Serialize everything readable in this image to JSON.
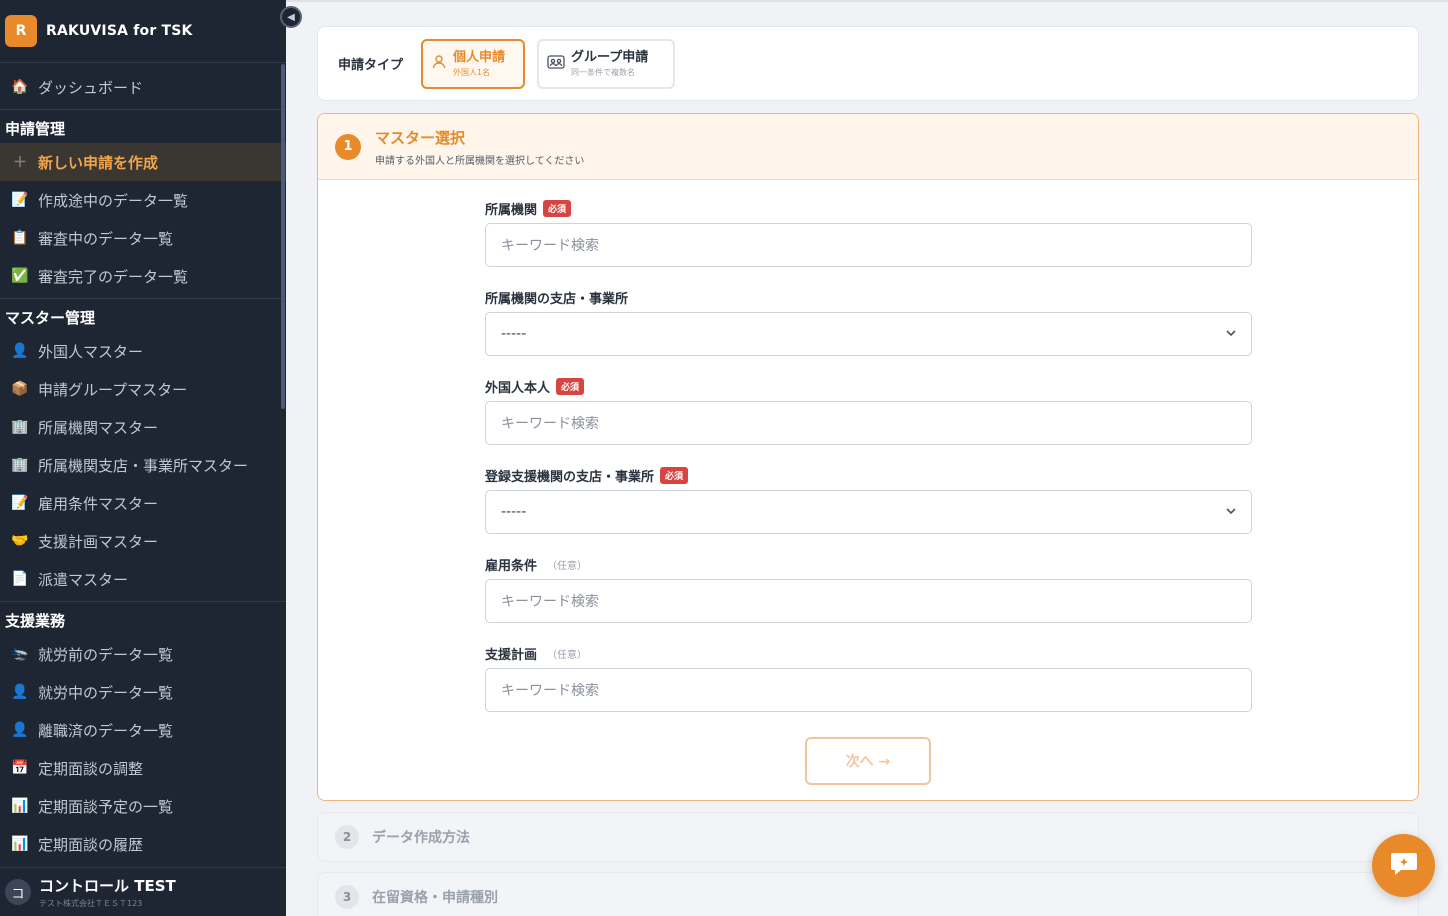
{
  "brand": {
    "logo_letter": "R",
    "title": "RAKUVISA for TSK"
  },
  "sidebar": {
    "dashboard": {
      "icon": "home-icon",
      "label": "ダッシュボード"
    },
    "sections": [
      {
        "title": "申請管理",
        "items": [
          {
            "icon": "plus-icon",
            "label": "新しい申請を作成",
            "active": true
          },
          {
            "icon": "memo-icon",
            "label": "作成途中のデータ一覧"
          },
          {
            "icon": "clipboard-icon",
            "label": "審査中のデータ一覧"
          },
          {
            "icon": "check-icon",
            "label": "審査完了のデータ一覧"
          }
        ]
      },
      {
        "title": "マスター管理",
        "items": [
          {
            "icon": "person-icon",
            "label": "外国人マスター"
          },
          {
            "icon": "package-icon",
            "label": "申請グループマスター"
          },
          {
            "icon": "building-icon",
            "label": "所属機関マスター"
          },
          {
            "icon": "building-icon",
            "label": "所属機関支店・事業所マスター"
          },
          {
            "icon": "memo-icon",
            "label": "雇用条件マスター"
          },
          {
            "icon": "handshake-icon",
            "label": "支援計画マスター"
          },
          {
            "icon": "document-icon",
            "label": "派遣マスター"
          }
        ]
      },
      {
        "title": "支援業務",
        "items": [
          {
            "icon": "airplane-icon",
            "label": "就労前のデータ一覧"
          },
          {
            "icon": "person-icon",
            "label": "就労中のデータ一覧"
          },
          {
            "icon": "person-icon",
            "label": "離職済のデータ一覧"
          },
          {
            "icon": "calendar-icon",
            "label": "定期面談の調整"
          },
          {
            "icon": "chart-icon",
            "label": "定期面談予定の一覧"
          },
          {
            "icon": "chart-icon",
            "label": "定期面談の履歴"
          }
        ]
      }
    ]
  },
  "user": {
    "avatar_letter": "コ",
    "name": "コントロール TEST",
    "org": "テスト株式会社ＴＥＳＴ123"
  },
  "application_type": {
    "label": "申請タイプ",
    "individual": {
      "title": "個人申請",
      "sub": "外国人1名"
    },
    "group": {
      "title": "グループ申請",
      "sub": "同一条件で複数名"
    }
  },
  "step1": {
    "number": "1",
    "title": "マスター選択",
    "description": "申請する外国人と所属機関を選択してください",
    "fields": [
      {
        "label": "所属機関",
        "badge": "必須",
        "type": "search",
        "placeholder": "キーワード検索"
      },
      {
        "label": "所属機関の支店・事業所",
        "badge": "",
        "type": "select",
        "value": "-----"
      },
      {
        "label": "外国人本人",
        "badge": "必須",
        "type": "search",
        "placeholder": "キーワード検索"
      },
      {
        "label": "登録支援機関の支店・事業所",
        "badge": "必須",
        "type": "select",
        "value": "-----"
      },
      {
        "label": "雇用条件",
        "optional": "（任意）",
        "type": "search",
        "placeholder": "キーワード検索"
      },
      {
        "label": "支援計画",
        "optional": "（任意）",
        "type": "search",
        "placeholder": "キーワード検索"
      }
    ],
    "next_label": "次へ →"
  },
  "step2": {
    "number": "2",
    "title": "データ作成方法"
  },
  "step3": {
    "number": "3",
    "title": "在留資格・申請種別"
  },
  "colors": {
    "accent": "#e8892a",
    "sidebar_bg": "#1e2533",
    "required": "#d64541"
  }
}
